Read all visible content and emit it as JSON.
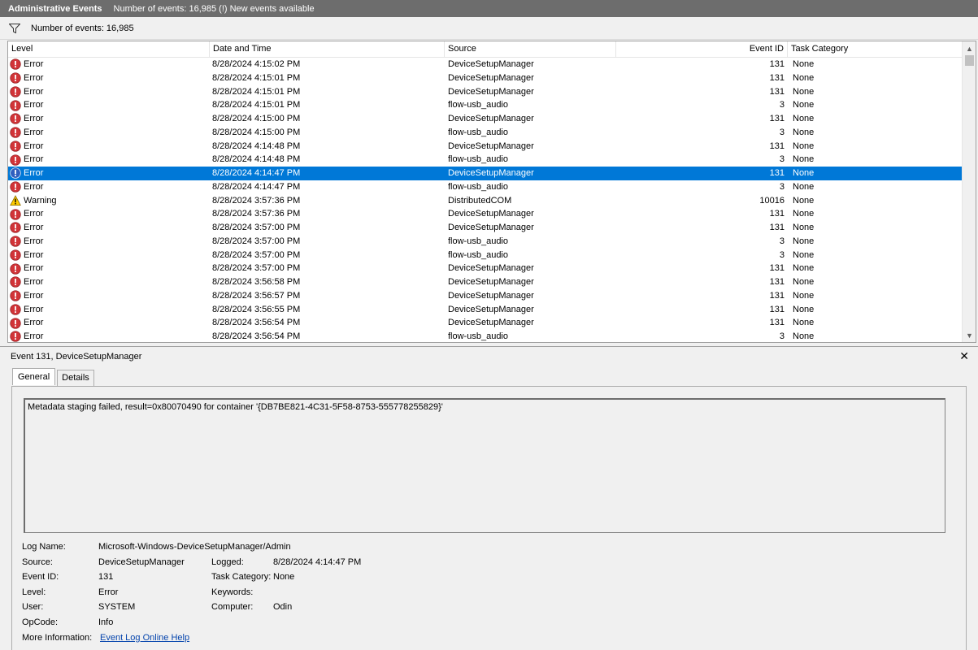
{
  "header": {
    "title": "Administrative Events",
    "event_count_text": "Number of events: 16,985 (!) New events available"
  },
  "filter": {
    "text": "Number of events: 16,985"
  },
  "columns": {
    "level": "Level",
    "date": "Date and Time",
    "source": "Source",
    "event_id": "Event ID",
    "category": "Task Category"
  },
  "rows": [
    {
      "level": "Error",
      "date": "8/28/2024 4:15:02 PM",
      "source": "DeviceSetupManager",
      "id": "131",
      "cat": "None"
    },
    {
      "level": "Error",
      "date": "8/28/2024 4:15:01 PM",
      "source": "DeviceSetupManager",
      "id": "131",
      "cat": "None"
    },
    {
      "level": "Error",
      "date": "8/28/2024 4:15:01 PM",
      "source": "DeviceSetupManager",
      "id": "131",
      "cat": "None"
    },
    {
      "level": "Error",
      "date": "8/28/2024 4:15:01 PM",
      "source": "flow-usb_audio",
      "id": "3",
      "cat": "None"
    },
    {
      "level": "Error",
      "date": "8/28/2024 4:15:00 PM",
      "source": "DeviceSetupManager",
      "id": "131",
      "cat": "None"
    },
    {
      "level": "Error",
      "date": "8/28/2024 4:15:00 PM",
      "source": "flow-usb_audio",
      "id": "3",
      "cat": "None"
    },
    {
      "level": "Error",
      "date": "8/28/2024 4:14:48 PM",
      "source": "DeviceSetupManager",
      "id": "131",
      "cat": "None"
    },
    {
      "level": "Error",
      "date": "8/28/2024 4:14:48 PM",
      "source": "flow-usb_audio",
      "id": "3",
      "cat": "None"
    },
    {
      "level": "Error",
      "date": "8/28/2024 4:14:47 PM",
      "source": "DeviceSetupManager",
      "id": "131",
      "cat": "None"
    },
    {
      "level": "Error",
      "date": "8/28/2024 4:14:47 PM",
      "source": "flow-usb_audio",
      "id": "3",
      "cat": "None"
    },
    {
      "level": "Warning",
      "date": "8/28/2024 3:57:36 PM",
      "source": "DistributedCOM",
      "id": "10016",
      "cat": "None"
    },
    {
      "level": "Error",
      "date": "8/28/2024 3:57:36 PM",
      "source": "DeviceSetupManager",
      "id": "131",
      "cat": "None"
    },
    {
      "level": "Error",
      "date": "8/28/2024 3:57:00 PM",
      "source": "DeviceSetupManager",
      "id": "131",
      "cat": "None"
    },
    {
      "level": "Error",
      "date": "8/28/2024 3:57:00 PM",
      "source": "flow-usb_audio",
      "id": "3",
      "cat": "None"
    },
    {
      "level": "Error",
      "date": "8/28/2024 3:57:00 PM",
      "source": "flow-usb_audio",
      "id": "3",
      "cat": "None"
    },
    {
      "level": "Error",
      "date": "8/28/2024 3:57:00 PM",
      "source": "DeviceSetupManager",
      "id": "131",
      "cat": "None"
    },
    {
      "level": "Error",
      "date": "8/28/2024 3:56:58 PM",
      "source": "DeviceSetupManager",
      "id": "131",
      "cat": "None"
    },
    {
      "level": "Error",
      "date": "8/28/2024 3:56:57 PM",
      "source": "DeviceSetupManager",
      "id": "131",
      "cat": "None"
    },
    {
      "level": "Error",
      "date": "8/28/2024 3:56:55 PM",
      "source": "DeviceSetupManager",
      "id": "131",
      "cat": "None"
    },
    {
      "level": "Error",
      "date": "8/28/2024 3:56:54 PM",
      "source": "DeviceSetupManager",
      "id": "131",
      "cat": "None"
    },
    {
      "level": "Error",
      "date": "8/28/2024 3:56:54 PM",
      "source": "flow-usb_audio",
      "id": "3",
      "cat": "None"
    }
  ],
  "selected_row": 8,
  "detail": {
    "title": "Event 131, DeviceSetupManager",
    "close": "✕",
    "tabs": [
      "General",
      "Details"
    ],
    "message": "Metadata staging failed, result=0x80070490 for container '{DB7BE821-4C31-5F58-8753-555778255829}'",
    "props": {
      "log_name_label": "Log Name:",
      "log_name": "Microsoft-Windows-DeviceSetupManager/Admin",
      "source_label": "Source:",
      "source": "DeviceSetupManager",
      "logged_label": "Logged:",
      "logged": "8/28/2024 4:14:47 PM",
      "event_id_label": "Event ID:",
      "event_id": "131",
      "task_label": "Task Category:",
      "task": "None",
      "level_label": "Level:",
      "level": "Error",
      "keywords_label": "Keywords:",
      "keywords": "",
      "user_label": "User:",
      "user": "SYSTEM",
      "computer_label": "Computer:",
      "computer": "Odin",
      "opcode_label": "OpCode:",
      "opcode": "Info",
      "more_label": "More Information:",
      "more": "Event Log Online Help"
    }
  },
  "icons": {
    "error": "error-icon",
    "warning": "warning-icon",
    "info": "info-icon",
    "filter": "filter-icon"
  },
  "colors": {
    "selection": "#0078d7",
    "error": "#d13438",
    "warning": "#ffcc00",
    "titlebar": "#6d6d6d"
  }
}
